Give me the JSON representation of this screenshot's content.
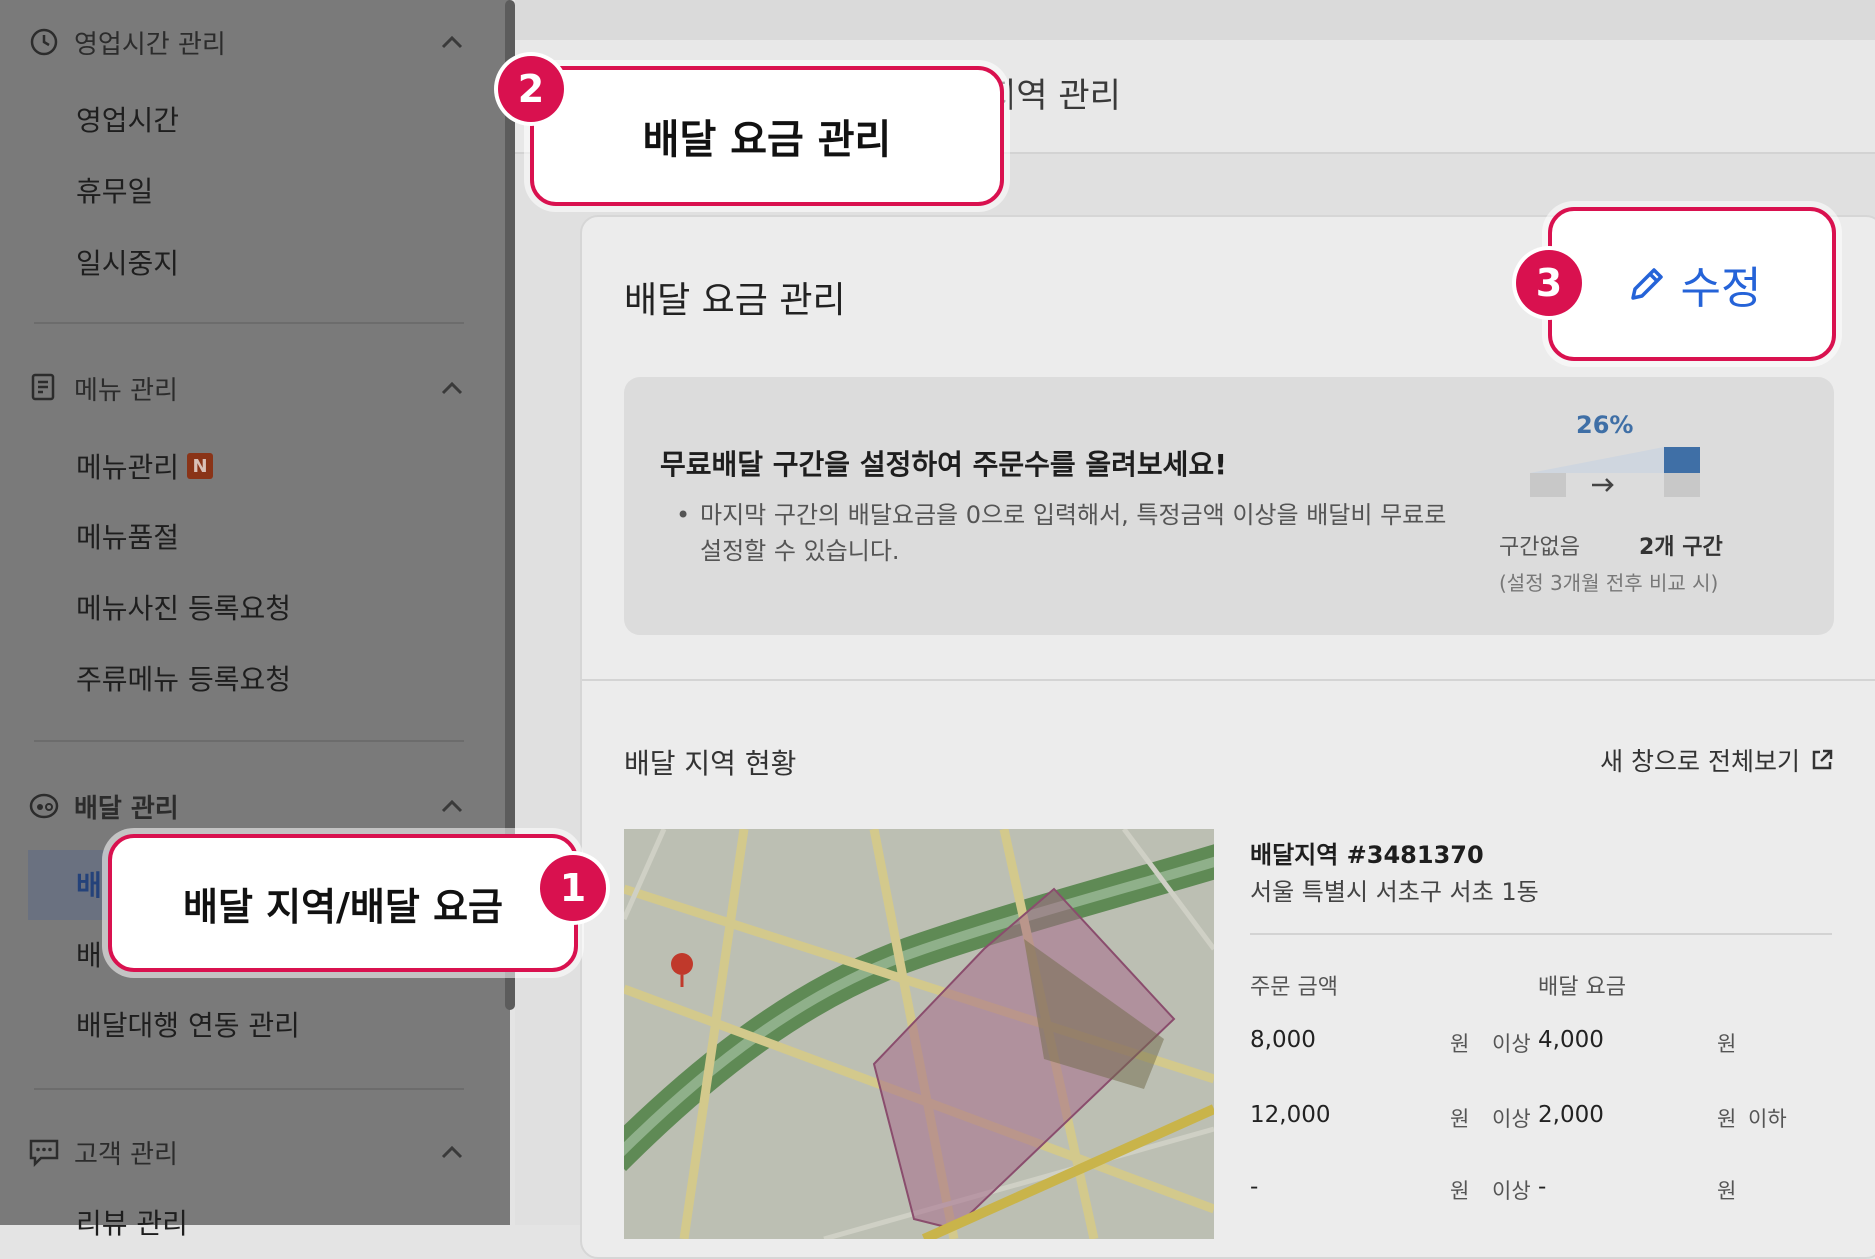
{
  "sidebar": {
    "sections": [
      {
        "label": "영업시간 관리",
        "icon": "clock-icon",
        "items": [
          "영업시간",
          "휴무일",
          "일시중지"
        ]
      },
      {
        "label": "메뉴 관리",
        "icon": "menu-doc-icon",
        "items": [
          "메뉴관리",
          "메뉴품절",
          "메뉴사진 등록요청",
          "주류메뉴 등록요청"
        ],
        "badge": "N"
      },
      {
        "label": "배달 관리",
        "icon": "delivery-icon",
        "items": [
          "배",
          "배",
          "배달대행 연동 관리"
        ]
      },
      {
        "label": "고객 관리",
        "icon": "chat-icon",
        "items": [
          "리뷰 관리"
        ]
      }
    ]
  },
  "main": {
    "title": "지역 관리",
    "card_title": "배달 요금 관리",
    "edit_label": "수정",
    "info": {
      "title": "무료배달 구간을 설정하여 주문수를 올려보세요!",
      "bullet": "•",
      "text": "마지막 구간의 배달요금을 0으로 입력해서, 특정금액 이상을 배달비 무료로 설정할 수 있습니다.",
      "percent": "26%",
      "before_label": "구간없음",
      "after_label": "2개 구간",
      "note": "(설정 3개월 전후 비교 시)"
    },
    "area_title": "배달 지역 현황",
    "new_window": "새 창으로 전체보기",
    "zone": {
      "name": "배달지역 #3481370",
      "address": "서울 특별시 서초구 서초 1동",
      "col_order": "주문 금액",
      "col_fee": "배달 요금",
      "rows": [
        {
          "amount": "8,000",
          "unit1": "원",
          "cond1": "이상",
          "fee": "4,000",
          "unit2": "원",
          "cond2": ""
        },
        {
          "amount": "12,000",
          "unit1": "원",
          "cond1": "이상",
          "fee": "2,000",
          "unit2": "원",
          "cond2": "이하"
        },
        {
          "amount": "-",
          "unit1": "원",
          "cond1": "이상",
          "fee": "-",
          "unit2": "원",
          "cond2": ""
        }
      ]
    }
  },
  "callouts": {
    "c1": {
      "number": "1",
      "text": "배달 지역/배달 요금"
    },
    "c2": {
      "number": "2",
      "text": "배달 요금 관리"
    },
    "c3": {
      "number": "3"
    }
  },
  "colors": {
    "accent": "#d9114f",
    "link": "#2563d8",
    "chart_bar": "#3f6fa6"
  }
}
